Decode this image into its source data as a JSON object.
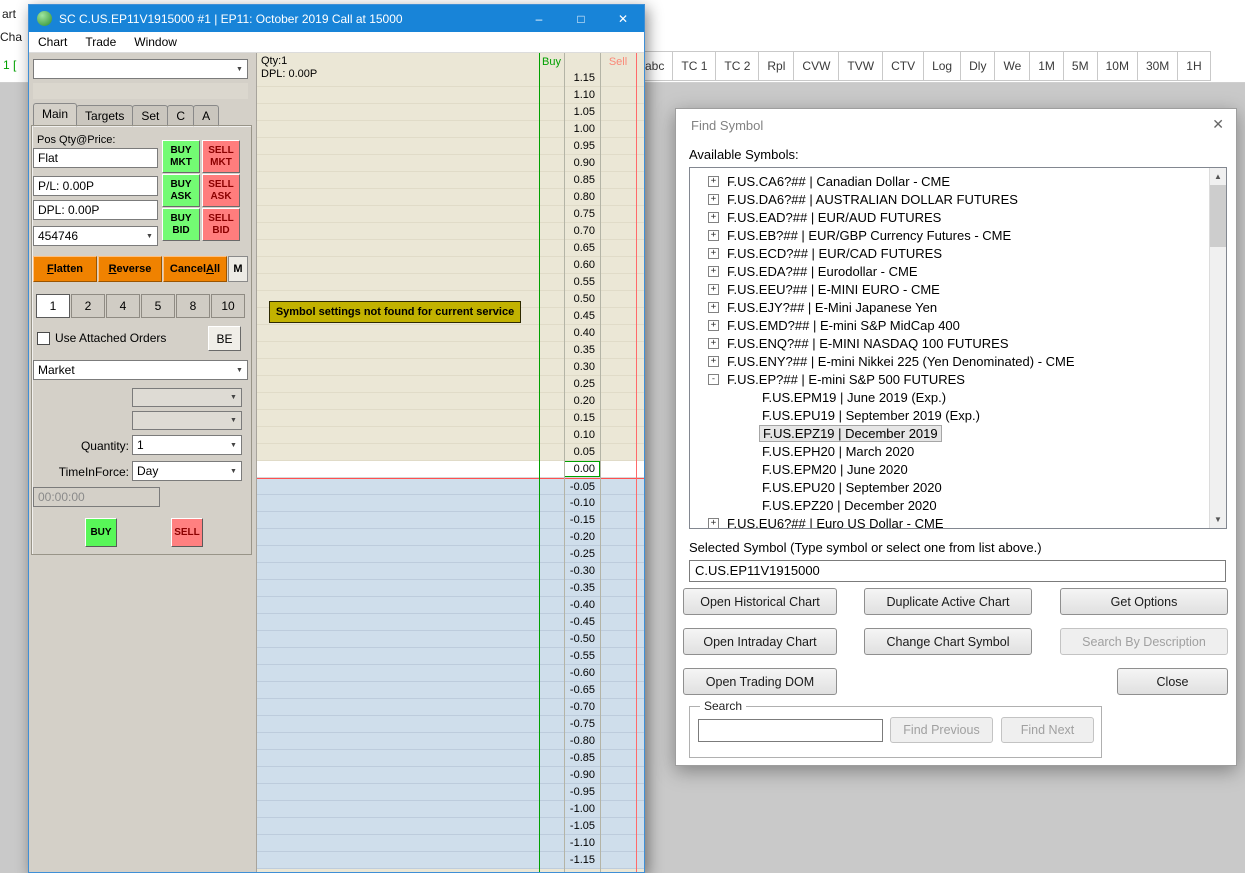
{
  "colors": {
    "titlebar": "#1884d8",
    "buy_green": "#73fb73",
    "sell_red": "#ff7d7d",
    "action_orange": "#f08200",
    "message_yellow": "#c2b200",
    "dom_above_bg": "#ebe7d6",
    "dom_below_bg": "#cfdeeb",
    "buy_header_green": "#00a000",
    "sell_header_salmon": "#fa8878"
  },
  "background": {
    "fragments": [
      "art",
      "Cha",
      "1 ["
    ]
  },
  "toolbar": {
    "buttons": [
      "abc",
      "TC 1",
      "TC 2",
      "Rpl",
      "CVW",
      "TVW",
      "CTV",
      "Log",
      "Dly",
      "We",
      "1M",
      "5M",
      "10M",
      "30M",
      "1H"
    ]
  },
  "trading_window": {
    "title": "SC C.US.EP11V1915000  #1 | EP11: October 2019 Call at 15000",
    "menu": [
      "Chart",
      "Trade",
      "Window"
    ],
    "controls": {
      "symbol_combo_value": "",
      "tabs": [
        "Main",
        "Targets",
        "Set",
        "C",
        "A"
      ],
      "pos_label": "Pos Qty@Price:",
      "pos_value": "Flat",
      "pl_value": "P/L: 0.00P",
      "dpl_value": "DPL: 0.00P",
      "account_value": "454746",
      "buy_mkt": {
        "line1": "BUY",
        "line2": "MKT"
      },
      "sell_mkt": {
        "line1": "SELL",
        "line2": "MKT"
      },
      "buy_ask": {
        "line1": "BUY",
        "line2": "ASK"
      },
      "sell_ask": {
        "line1": "SELL",
        "line2": "ASK"
      },
      "buy_bid": {
        "line1": "BUY",
        "line2": "BID"
      },
      "sell_bid": {
        "line1": "SELL",
        "line2": "BID"
      },
      "flatten": {
        "pre": "",
        "accel": "F",
        "post": "latten"
      },
      "reverse": {
        "pre": "",
        "accel": "R",
        "post": "everse"
      },
      "cancel_all": {
        "pre": "Cancel",
        "accel": "A",
        "post": "ll"
      },
      "m_button": "M",
      "presets": [
        "1",
        "2",
        "4",
        "5",
        "8",
        "10"
      ],
      "selected_preset": "1",
      "attached_label": "Use Attached Orders",
      "be_button": "BE",
      "order_type_value": "Market",
      "quantity_label": "Quantity:",
      "quantity_value": "1",
      "tif_label": "TimeInForce:",
      "tif_value": "Day",
      "timer_value": "00:00:00",
      "buy_button": "BUY",
      "sell_button": "SELL"
    },
    "dom": {
      "qty_label": "Qty:1",
      "dpl_label": "DPL: 0.00P",
      "buy_header": "Buy",
      "sell_header": "Sell",
      "message": "Symbol settings not found for current service",
      "prices": [
        "1.15",
        "1.10",
        "1.05",
        "1.00",
        "0.95",
        "0.90",
        "0.85",
        "0.80",
        "0.75",
        "0.70",
        "0.65",
        "0.60",
        "0.55",
        "0.50",
        "0.45",
        "0.40",
        "0.35",
        "0.30",
        "0.25",
        "0.20",
        "0.15",
        "0.10",
        "0.05",
        "0.00",
        "-0.05",
        "-0.10",
        "-0.15",
        "-0.20",
        "-0.25",
        "-0.30",
        "-0.35",
        "-0.40",
        "-0.45",
        "-0.50",
        "-0.55",
        "-0.60",
        "-0.65",
        "-0.70",
        "-0.75",
        "-0.80",
        "-0.85",
        "-0.90",
        "-0.95",
        "-1.00",
        "-1.05",
        "-1.10",
        "-1.15"
      ]
    }
  },
  "find_symbol": {
    "title": "Find Symbol",
    "available_label": "Available Symbols:",
    "items": [
      {
        "expand": "+",
        "indent": 0,
        "label": "F.US.CA6?##  |  Canadian Dollar - CME"
      },
      {
        "expand": "+",
        "indent": 0,
        "label": "F.US.DA6?##  |  AUSTRALIAN DOLLAR FUTURES"
      },
      {
        "expand": "+",
        "indent": 0,
        "label": "F.US.EAD?##  |  EUR/AUD FUTURES"
      },
      {
        "expand": "+",
        "indent": 0,
        "label": "F.US.EB?##  |  EUR/GBP Currency Futures - CME"
      },
      {
        "expand": "+",
        "indent": 0,
        "label": "F.US.ECD?##  |  EUR/CAD FUTURES"
      },
      {
        "expand": "+",
        "indent": 0,
        "label": "F.US.EDA?##  |  Eurodollar - CME"
      },
      {
        "expand": "+",
        "indent": 0,
        "label": "F.US.EEU?##  |  E-MINI EURO - CME"
      },
      {
        "expand": "+",
        "indent": 0,
        "label": "F.US.EJY?##  |  E-Mini Japanese Yen"
      },
      {
        "expand": "+",
        "indent": 0,
        "label": "F.US.EMD?##  |  E-mini S&P MidCap 400"
      },
      {
        "expand": "+",
        "indent": 0,
        "label": "F.US.ENQ?##  |  E-MINI NASDAQ 100 FUTURES"
      },
      {
        "expand": "+",
        "indent": 0,
        "label": "F.US.ENY?##  |  E-mini Nikkei 225 (Yen Denominated) - CME"
      },
      {
        "expand": "-",
        "indent": 0,
        "label": "F.US.EP?##  |  E-mini S&P 500 FUTURES"
      },
      {
        "expand": "",
        "indent": 1,
        "label": "F.US.EPM19  |  June 2019 (Exp.)"
      },
      {
        "expand": "",
        "indent": 1,
        "label": "F.US.EPU19  |  September 2019 (Exp.)"
      },
      {
        "expand": "",
        "indent": 1,
        "label": "F.US.EPZ19  |  December 2019",
        "selected": true
      },
      {
        "expand": "",
        "indent": 1,
        "label": "F.US.EPH20  |  March 2020"
      },
      {
        "expand": "",
        "indent": 1,
        "label": "F.US.EPM20  |  June 2020"
      },
      {
        "expand": "",
        "indent": 1,
        "label": "F.US.EPU20  |  September 2020"
      },
      {
        "expand": "",
        "indent": 1,
        "label": "F.US.EPZ20  |  December 2020"
      },
      {
        "expand": "+",
        "indent": 0,
        "label": "F.US.EU6?##  |  Euro US Dollar - CME"
      }
    ],
    "selected_label": "Selected Symbol (Type symbol or select one from list above.)",
    "selected_value": "C.US.EP11V1915000",
    "buttons": {
      "open_historical": "Open Historical Chart",
      "duplicate": "Duplicate Active Chart",
      "get_options": "Get Options",
      "open_intraday": "Open Intraday Chart",
      "change_symbol": "Change Chart Symbol",
      "search_desc": "Search By Description",
      "open_dom": "Open Trading DOM",
      "close": "Close"
    },
    "search": {
      "label": "Search",
      "input_value": "",
      "find_prev": "Find Previous",
      "find_next": "Find Next"
    }
  }
}
